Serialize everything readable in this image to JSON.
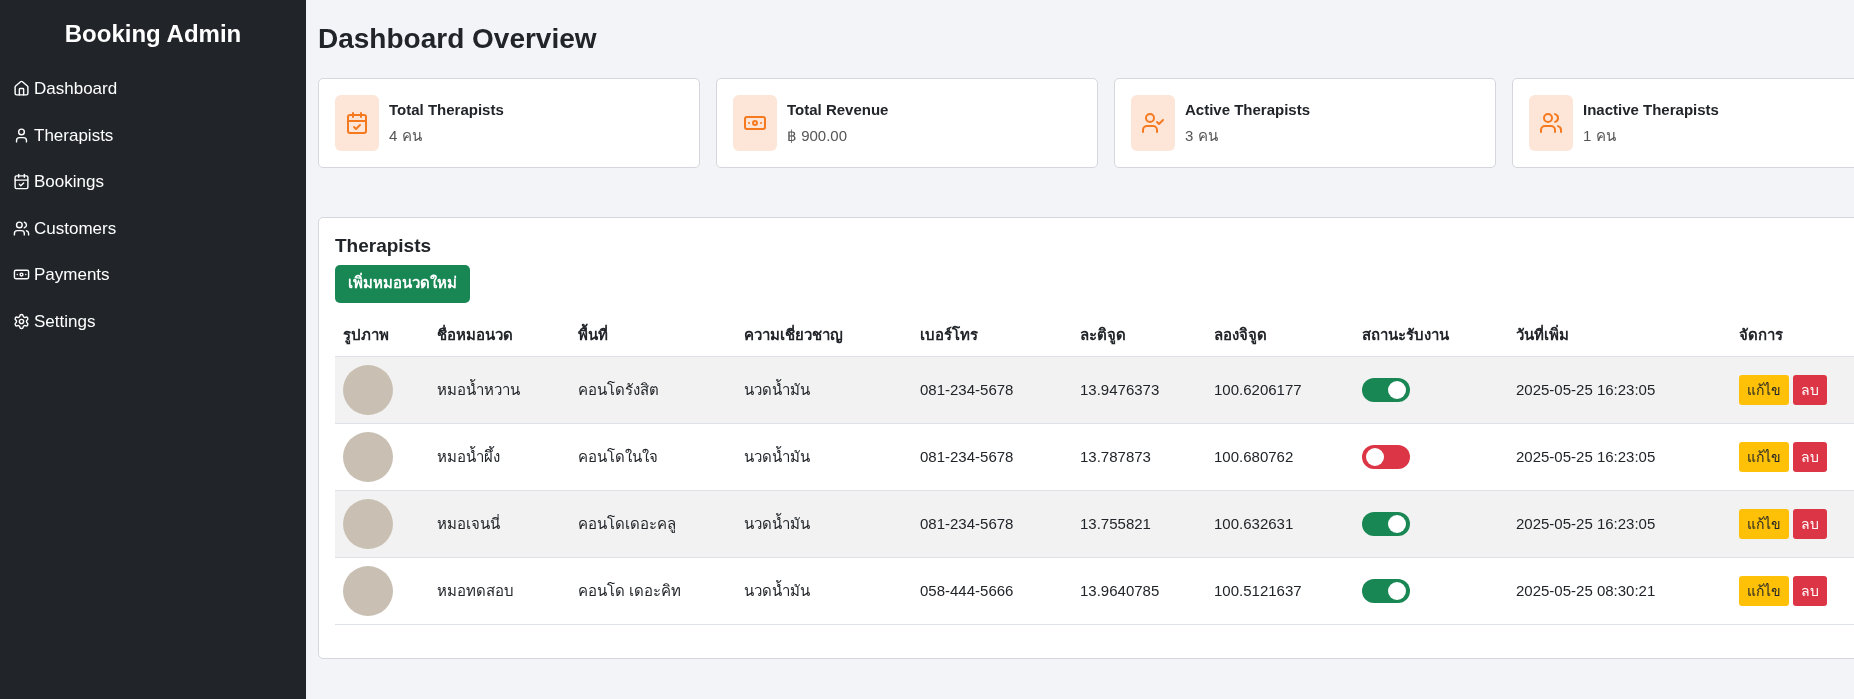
{
  "sidebar": {
    "title": "Booking Admin",
    "items": [
      {
        "label": "Dashboard"
      },
      {
        "label": "Therapists"
      },
      {
        "label": "Bookings"
      },
      {
        "label": "Customers"
      },
      {
        "label": "Payments"
      },
      {
        "label": "Settings"
      }
    ]
  },
  "page_title": "Dashboard Overview",
  "stats": [
    {
      "title": "Total Therapists",
      "value": "4 คน"
    },
    {
      "title": "Total Revenue",
      "value": "฿ 900.00"
    },
    {
      "title": "Active Therapists",
      "value": "3 คน"
    },
    {
      "title": "Inactive Therapists",
      "value": "1 คน"
    }
  ],
  "therapists": {
    "title": "Therapists",
    "add_button": "เพิ่มหมอนวดใหม่",
    "columns": [
      "รูปภาพ",
      "ชื่อหมอนวด",
      "พื้นที่",
      "ความเชี่ยวชาญ",
      "เบอร์โทร",
      "ละติจูด",
      "ลองจิจูด",
      "สถานะรับงาน",
      "วันที่เพิ่ม",
      "จัดการ"
    ],
    "rows": [
      {
        "name": "หมอน้ำหวาน",
        "area": "คอนโดรังสิต",
        "specialty": "นวดน้ำมัน",
        "phone": "081-234-5678",
        "lat": "13.9476373",
        "lng": "100.6206177",
        "on": true,
        "added": "2025-05-25 16:23:05",
        "edit": "แก้ไข",
        "delete": "ลบ"
      },
      {
        "name": "หมอน้ำผึ้ง",
        "area": "คอนโดในใจ",
        "specialty": "นวดน้ำมัน",
        "phone": "081-234-5678",
        "lat": "13.787873",
        "lng": "100.680762",
        "on": false,
        "added": "2025-05-25 16:23:05",
        "edit": "แก้ไข",
        "delete": "ลบ"
      },
      {
        "name": "หมอเจนนี่",
        "area": "คอนโดเดอะคลู",
        "specialty": "นวดน้ำมัน",
        "phone": "081-234-5678",
        "lat": "13.755821",
        "lng": "100.632631",
        "on": true,
        "added": "2025-05-25 16:23:05",
        "edit": "แก้ไข",
        "delete": "ลบ"
      },
      {
        "name": "หมอทดสอบ",
        "area": "คอนโด เดอะคิท",
        "specialty": "นวดน้ำมัน",
        "phone": "058-444-5666",
        "lat": "13.9640785",
        "lng": "100.5121637",
        "on": true,
        "added": "2025-05-25 08:30:21",
        "edit": "แก้ไข",
        "delete": "ลบ"
      }
    ]
  }
}
